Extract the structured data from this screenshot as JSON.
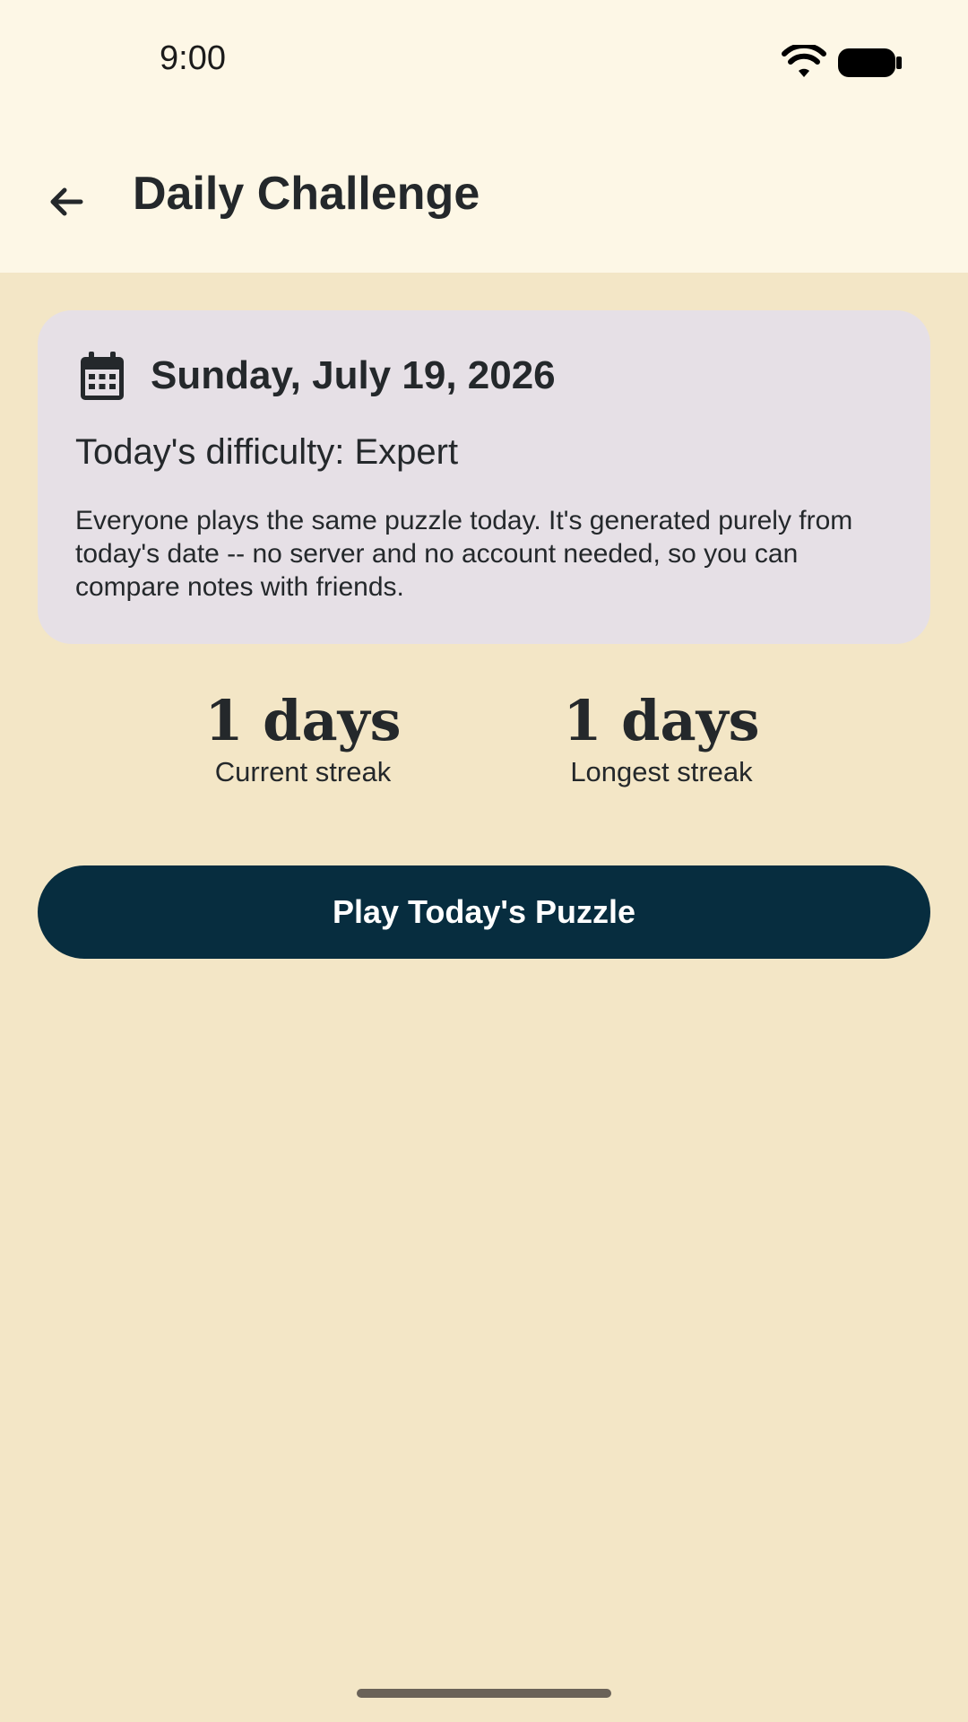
{
  "status_bar": {
    "time": "9:00",
    "wifi_icon": "wifi-icon",
    "battery_icon": "battery-icon"
  },
  "app_bar": {
    "back_icon": "arrow-left-icon",
    "title": "Daily Challenge"
  },
  "card": {
    "icon": "calendar-icon",
    "date": "Sunday, July 19, 2026",
    "difficulty": "Today's difficulty: Expert",
    "description": "Everyone plays the same puzzle today. It's generated purely from today's date -- no server and no account needed, so you can compare notes with friends."
  },
  "streaks": {
    "current": {
      "value": "1 days",
      "label": "Current streak"
    },
    "longest": {
      "value": "1 days",
      "label": "Longest streak"
    }
  },
  "actions": {
    "play_label": "Play Today's Puzzle"
  },
  "colors": {
    "background": "#f3e6c6",
    "header": "#fdf7e6",
    "card": "#e6e0e6",
    "button": "#072d3f",
    "text": "#24282b"
  }
}
